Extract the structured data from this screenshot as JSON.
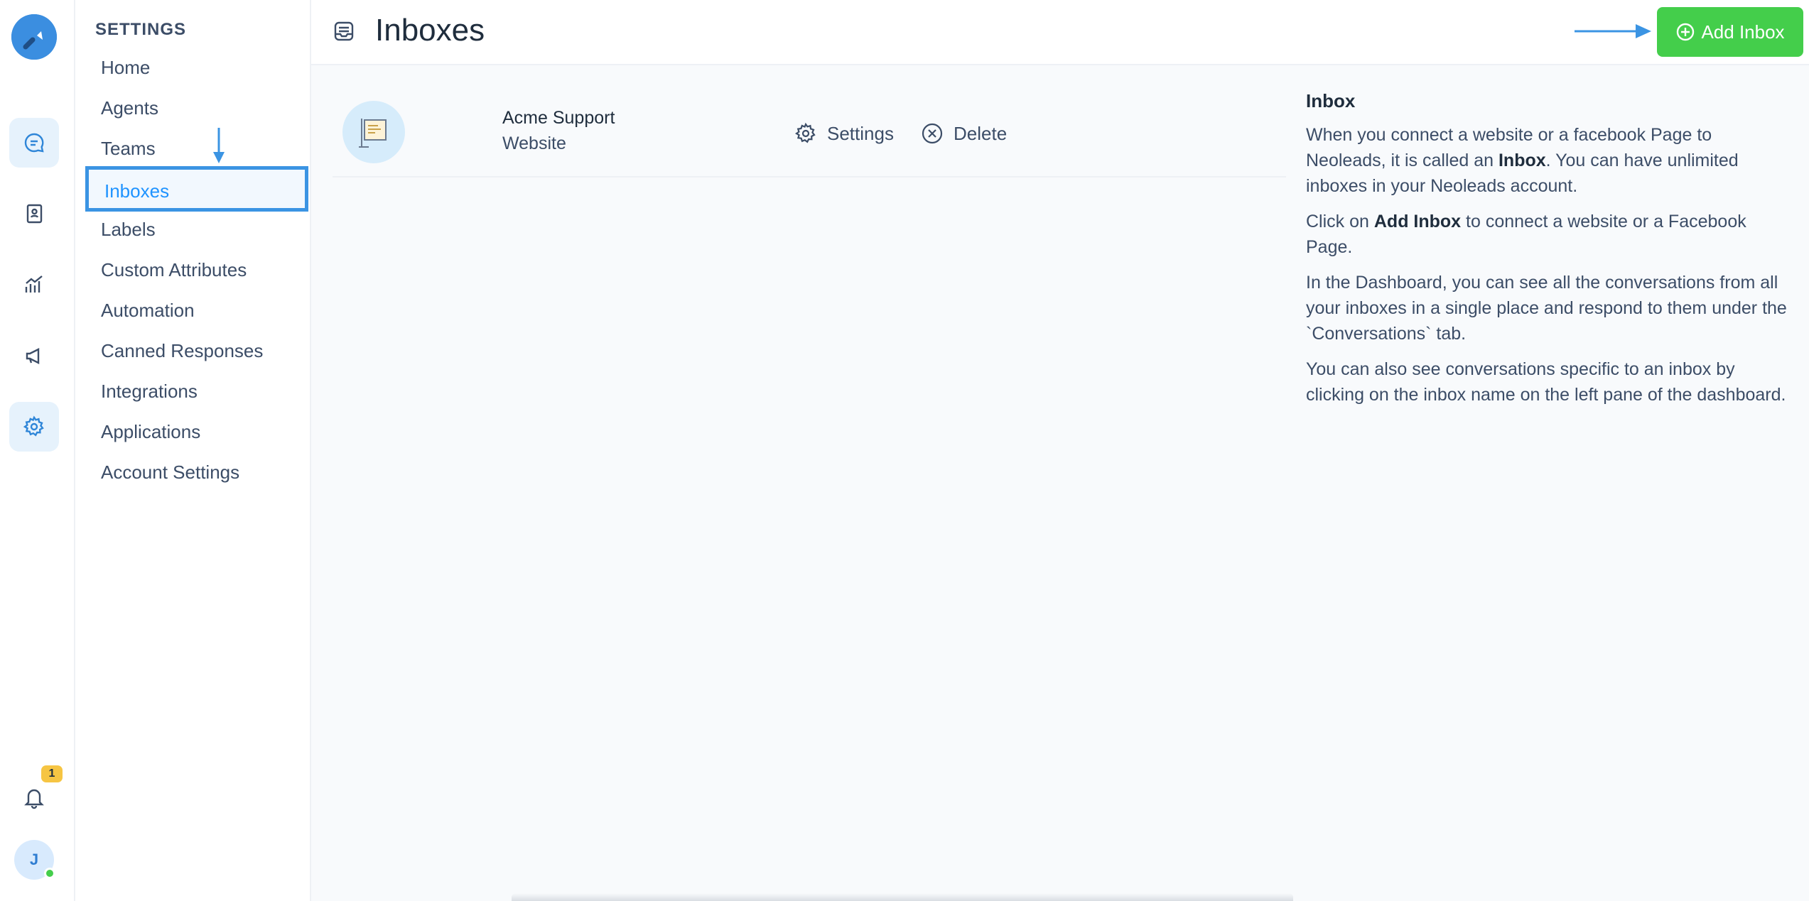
{
  "rail": {
    "notification_count": "1",
    "avatar_initial": "J"
  },
  "settings_menu": {
    "heading": "SETTINGS",
    "items": [
      {
        "label": "Home"
      },
      {
        "label": "Agents"
      },
      {
        "label": "Teams"
      },
      {
        "label": "Inboxes",
        "active": true
      },
      {
        "label": "Labels"
      },
      {
        "label": "Custom Attributes"
      },
      {
        "label": "Automation"
      },
      {
        "label": "Canned Responses"
      },
      {
        "label": "Integrations"
      },
      {
        "label": "Applications"
      },
      {
        "label": "Account Settings"
      }
    ]
  },
  "header": {
    "title": "Inboxes",
    "add_button_label": "Add Inbox"
  },
  "inboxes": [
    {
      "name": "Acme Support",
      "channel": "Website",
      "settings_label": "Settings",
      "delete_label": "Delete"
    }
  ],
  "help": {
    "title": "Inbox",
    "p1_a": "When you connect a website or a facebook Page to Neoleads, it is called an ",
    "p1_bold": "Inbox",
    "p1_b": ". You can have unlimited inboxes in your Neoleads account.",
    "p2_a": "Click on ",
    "p2_bold": "Add Inbox",
    "p2_b": " to connect a website or a Facebook Page.",
    "p3": "In the Dashboard, you can see all the conversations from all your inboxes in a single place and respond to them under the `Conversations` tab.",
    "p4": "You can also see conversations specific to an inbox by clicking on the inbox name on the left pane of the dashboard."
  },
  "colors": {
    "accent": "#1f93ff",
    "add_button": "#44ce4b",
    "annotation": "#3b94e3",
    "badge": "#f6c543"
  },
  "icons": [
    "logo-icon",
    "conversations-icon",
    "contacts-icon",
    "reports-icon",
    "campaigns-icon",
    "settings-icon",
    "bell-icon",
    "inbox-title-icon",
    "plus-circle-icon",
    "gear-icon",
    "close-circle-icon"
  ]
}
